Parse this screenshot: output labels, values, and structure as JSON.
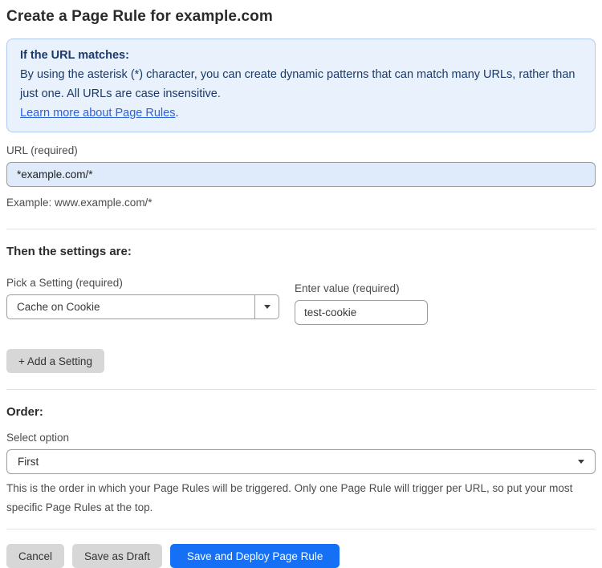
{
  "page": {
    "title": "Create a Page Rule for example.com"
  },
  "info_box": {
    "heading": "If the URL matches:",
    "body": "By using the asterisk (*) character, you can create dynamic patterns that can match many URLs, rather than just one. All URLs are case insensitive.",
    "link_label": "Learn more about Page Rules",
    "link_suffix": "."
  },
  "url_field": {
    "label": "URL (required)",
    "value": "*example.com/*",
    "helper": "Example: www.example.com/*"
  },
  "settings": {
    "heading": "Then the settings are:",
    "setting_label": "Pick a Setting (required)",
    "setting_selected": "Cache on Cookie",
    "value_label": "Enter value (required)",
    "value_value": "test-cookie",
    "add_button_label": "+ Add a Setting"
  },
  "order": {
    "heading": "Order:",
    "select_label": "Select option",
    "selected_option": "First",
    "helper": "This is the order in which your Page Rules will be triggered. Only one Page Rule will trigger per URL, so put your most specific Page Rules at the top."
  },
  "footer": {
    "cancel_label": "Cancel",
    "save_draft_label": "Save as Draft",
    "save_deploy_label": "Save and Deploy Page Rule"
  },
  "colors": {
    "info_box_bg": "#e9f1fc",
    "info_box_border": "#aecaf0",
    "info_text": "#1c3a68",
    "link_blue": "#2e62d8",
    "url_input_bg": "#dfeafa",
    "primary_button_blue": "#1670f5",
    "gray_button": "#d7d7d7"
  }
}
